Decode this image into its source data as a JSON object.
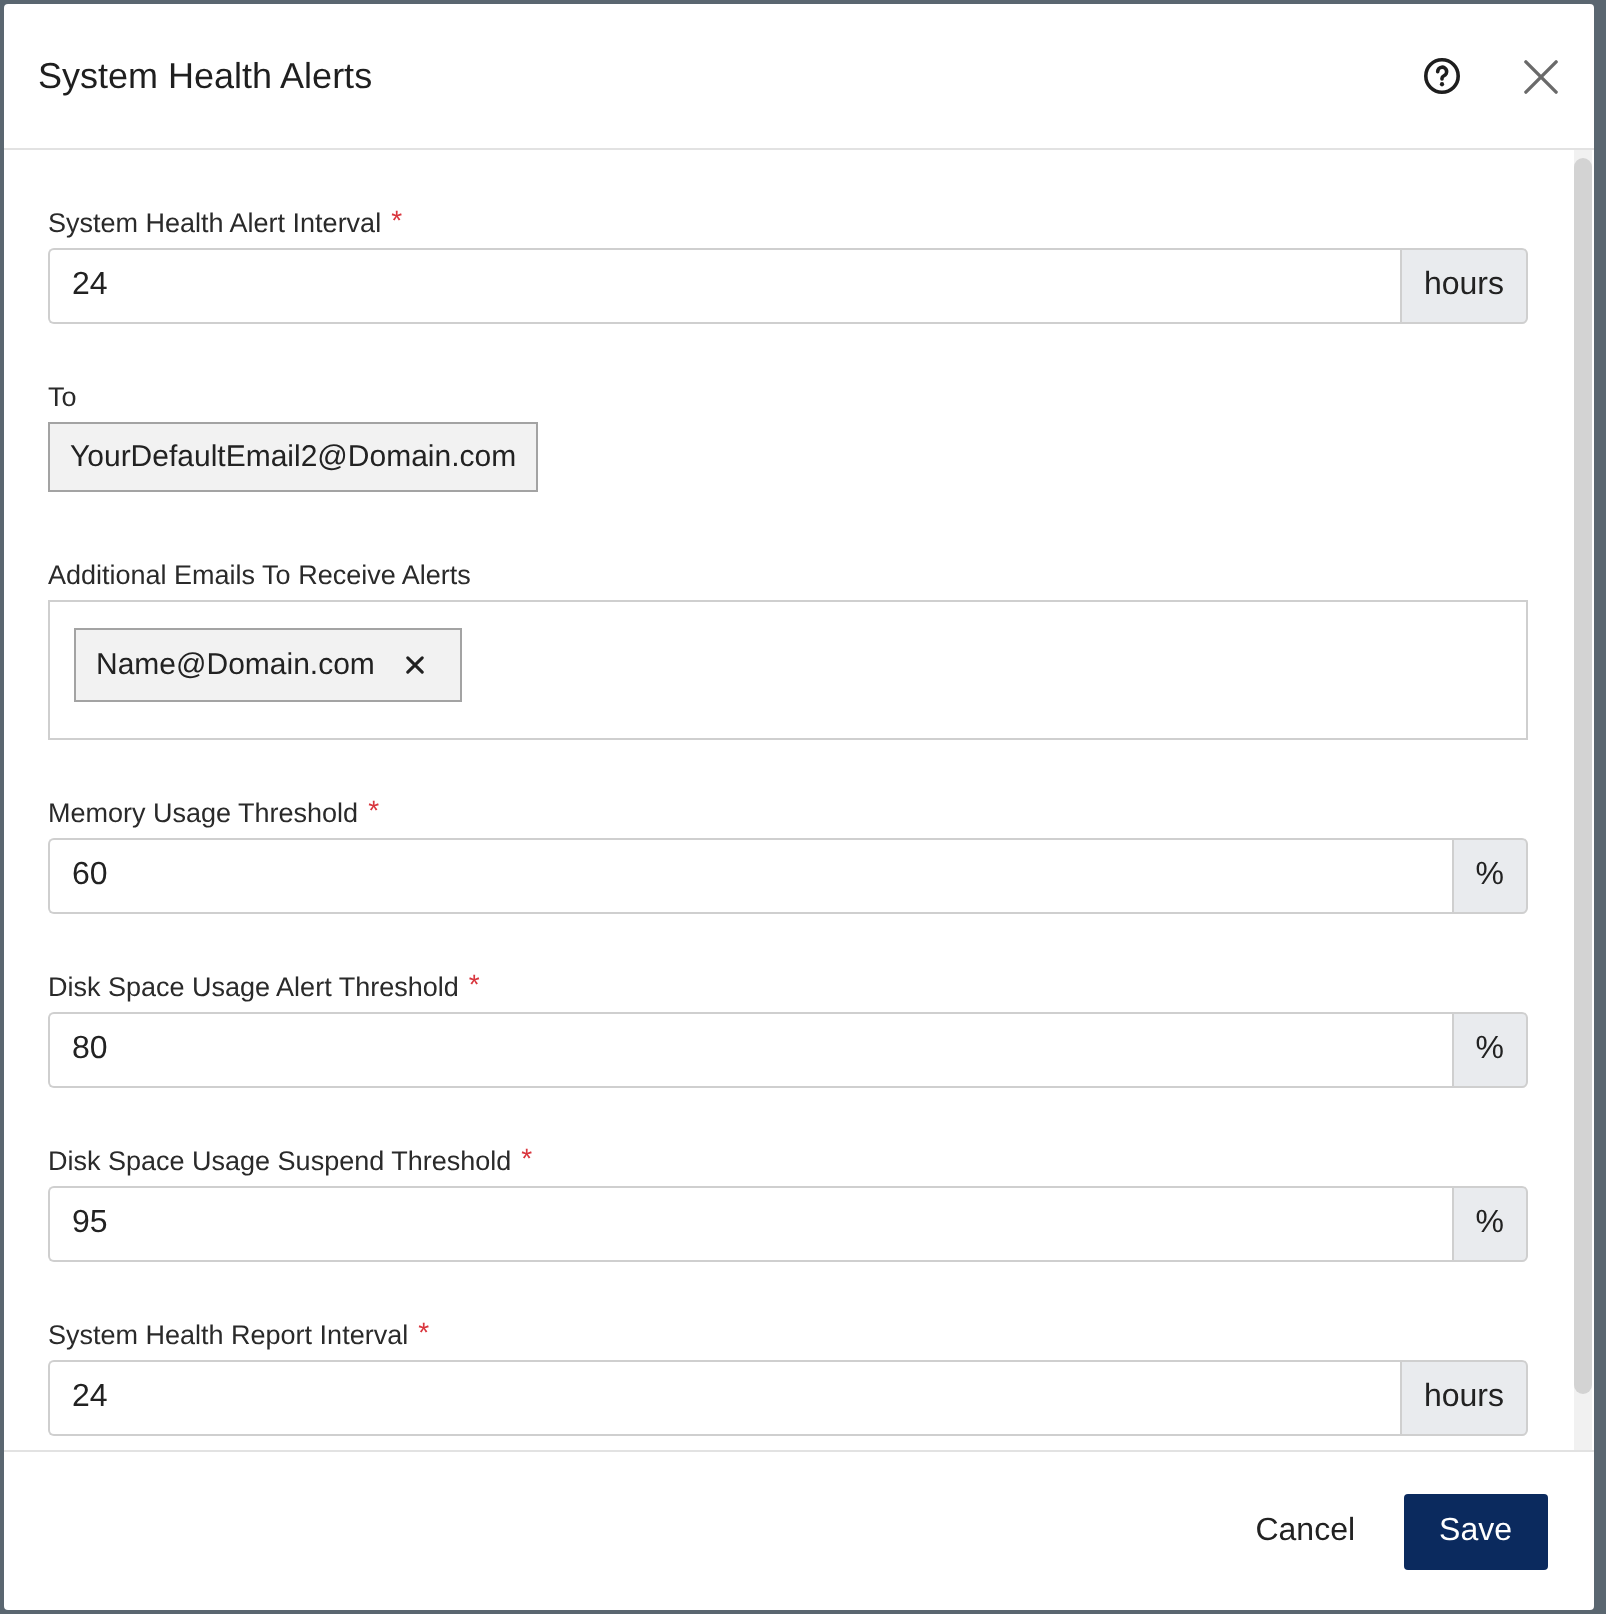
{
  "dialog": {
    "title": "System Health Alerts"
  },
  "fields": [
    {
      "kind": "unit_input",
      "label": "System Health Alert Interval",
      "required_mark": "*",
      "value": "24",
      "unit": "hours"
    },
    {
      "kind": "readonly",
      "label": "To",
      "value": "YourDefaultEmail2@Domain.com"
    },
    {
      "kind": "tags",
      "label": "Additional Emails To Receive Alerts",
      "tags": [
        {
          "text": "Name@Domain.com"
        }
      ]
    },
    {
      "kind": "unit_input",
      "label": "Memory Usage Threshold",
      "required_mark": "*",
      "value": "60",
      "unit": "%"
    },
    {
      "kind": "unit_input",
      "label": "Disk Space Usage Alert Threshold",
      "required_mark": "*",
      "value": "80",
      "unit": "%"
    },
    {
      "kind": "unit_input",
      "label": "Disk Space Usage Suspend Threshold",
      "required_mark": "*",
      "value": "95",
      "unit": "%"
    },
    {
      "kind": "unit_input",
      "label": "System Health Report Interval",
      "required_mark": "*",
      "value": "24",
      "unit": "hours"
    }
  ],
  "footer": {
    "buttons": [
      {
        "kind": "secondary",
        "label": "Cancel"
      },
      {
        "kind": "primary",
        "label": "Save"
      }
    ]
  }
}
